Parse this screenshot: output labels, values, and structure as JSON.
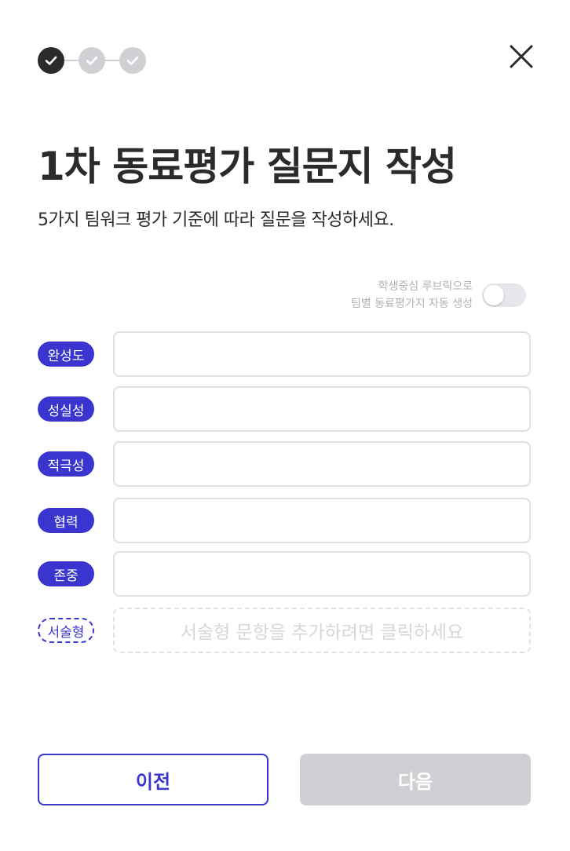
{
  "stepper": {
    "steps": [
      {
        "state": "done"
      },
      {
        "state": "todo"
      },
      {
        "state": "todo"
      }
    ],
    "icon": "check-icon"
  },
  "close_icon": "close-icon",
  "header": {
    "title": "1차 동료평가 질문지 작성",
    "subtitle": "5가지 팀워크 평가 기준에 따라 질문을 작성하세요."
  },
  "toggle": {
    "label_line1": "학생중심 루브릭으로",
    "label_line2": "팀별 동료평가지 자동 생성",
    "on": false
  },
  "criteria": [
    {
      "label": "완성도",
      "value": ""
    },
    {
      "label": "성실성",
      "value": ""
    },
    {
      "label": "적극성",
      "value": ""
    },
    {
      "label": "협력",
      "value": ""
    },
    {
      "label": "존중",
      "value": ""
    }
  ],
  "essay": {
    "label": "서술형",
    "placeholder": "서술형 문항을 추가하려면 클릭하세요"
  },
  "buttons": {
    "prev": "이전",
    "next": "다음"
  },
  "colors": {
    "accent": "#3a35cf",
    "step_done": "#2b2b2b",
    "step_todo": "#cfd0d3",
    "disabled": "#cfd0d3"
  }
}
